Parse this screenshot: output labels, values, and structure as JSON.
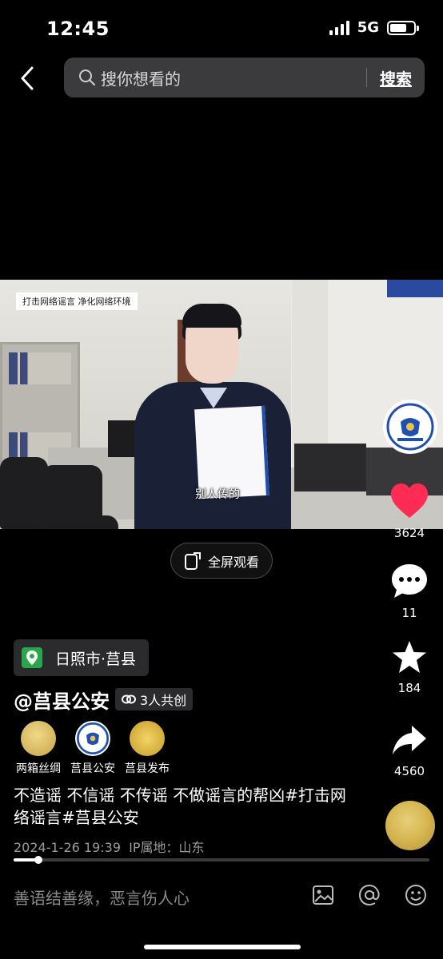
{
  "status_bar": {
    "time": "12:45",
    "network": "5G"
  },
  "search": {
    "placeholder": "搜你想看的",
    "button_label": "搜索"
  },
  "video": {
    "banner_text": "打击网络谣言  净化网络环境",
    "caption": "别人传的",
    "fullscreen_label": "全屏观看"
  },
  "actions": {
    "likes": "3624",
    "comments": "11",
    "favorites": "184",
    "shares": "4560"
  },
  "location": {
    "label": "日照市·莒县"
  },
  "author": {
    "name": "@莒县公安",
    "cocreate_label": "3人共创"
  },
  "creators": [
    {
      "name": "两箱丝绸",
      "color": "#e0c07a"
    },
    {
      "name": "莒县公安",
      "color": "#ffffff"
    },
    {
      "name": "莒县发布",
      "color": "#d9b54a"
    }
  ],
  "description": "不造谣 不信谣 不传谣 不做谣言的帮凶#打击网络谣言#莒县公安",
  "meta": {
    "date": "2024-1-26 19:39",
    "ip_location": "IP属地：山东"
  },
  "playback": {
    "progress_percent": 6
  },
  "comment": {
    "placeholder": "善语结善缘，恶言伤人心"
  },
  "colors": {
    "like": "#fe2c55",
    "location_icon": "#2aa74a",
    "police_blue": "#1f4fb0"
  }
}
